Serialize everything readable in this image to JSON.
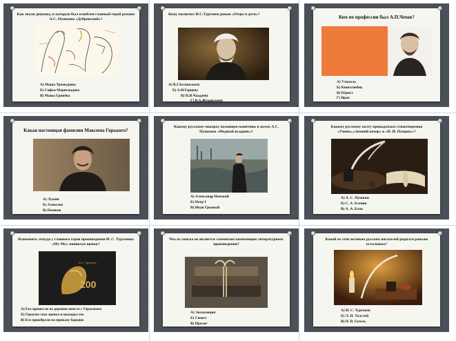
{
  "slides": [
    {
      "question": "Как звали девушку, в которую был влюблен главный герой романа А.С. Пушкина «Дубровский»?",
      "answers": [
        "А) Маша Троекурова",
        "Б) Софья Марисиадова",
        "В) Маша Гринёва"
      ]
    },
    {
      "question": "Кому посвятил И.С.Тургенев роман «Отцы и дети»?",
      "answers": [
        "А) В.Г.Белинскому",
        "Б) А.И.Герцену",
        "В) П.Я.Чаадаеву",
        "Г) В.А.Жуковскому"
      ]
    },
    {
      "question": "Кем по профессии был А.П.Чехов?",
      "answers": [
        "А) Учитель",
        "Б) Книголюбец",
        "В) Юрист",
        "Г) Врач"
      ]
    },
    {
      "question": "Какая настоящая фамилия Максима Горького?",
      "answers": [
        "А) Лужин",
        "Б) Алексеев",
        "В) Пешков"
      ]
    },
    {
      "question": "Какому русскому монарху посвящен памятник в поэме А.С. Пушкина «Медный всадник»?",
      "answers": [
        "А) Александр Невский",
        "Б) Петр I",
        "В) Иван Грозный"
      ]
    },
    {
      "question": "Какому русскому поэту принадлежат стихотворения «Узник»,«Зимний вечер» и «Н. И. Пущину»?",
      "answers": [
        "А) А. С. Пушкин",
        "Б) С. А. Есенин",
        "В) А. А. Блок"
      ]
    },
    {
      "question": "Вспомните, откуда у главного героя произведения И. С. Тургенева «Му-Му» появился щенок?",
      "answers": [
        "А) Его принесли из деревни вместе с Герасимом",
        "Б) Герасим спас щенка и выходил его",
        "В) Его приобрели по приказу барыни"
      ],
      "image_text": {
        "name": "И.С. Тургенев",
        "number": "200"
      }
    },
    {
      "question": "Что из списка не является элементом композиции литературного произведения?",
      "answers": [
        "А) Экспозиция",
        "Б) Сюжет",
        "В) Пролог"
      ]
    },
    {
      "question": "Какой из этих великих русских писателей родился раньше остальных?",
      "answers": [
        "А) И. С. Тургенев",
        "Б) Л. Н. Толстой",
        "В) Н. В. Гоголь"
      ]
    }
  ]
}
